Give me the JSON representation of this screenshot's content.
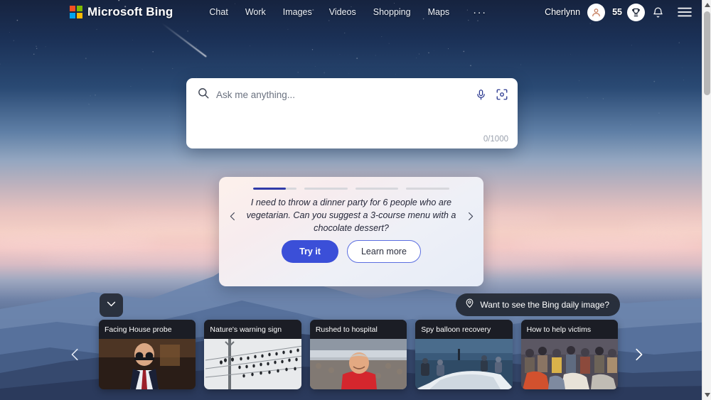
{
  "brand": {
    "name": "Microsoft Bing",
    "logo_icon": "microsoft-logo-icon"
  },
  "nav": {
    "items": [
      {
        "label": "Chat"
      },
      {
        "label": "Work"
      },
      {
        "label": "Images"
      },
      {
        "label": "Videos"
      },
      {
        "label": "Shopping"
      },
      {
        "label": "Maps"
      }
    ],
    "more_label": "···"
  },
  "account": {
    "username": "Cherlynn",
    "avatar_icon": "person-avatar-icon",
    "rewards_points": "55",
    "rewards_icon": "trophy-icon",
    "notifications_icon": "bell-icon",
    "menu_icon": "hamburger-menu-icon"
  },
  "search": {
    "placeholder": "Ask me anything...",
    "value": "",
    "search_icon": "search-icon",
    "mic_icon": "microphone-icon",
    "camera_icon": "visual-search-camera-icon",
    "counter": "0/1000"
  },
  "suggestion": {
    "progress": [
      75,
      0,
      0,
      0
    ],
    "prompt": "I need to throw a dinner party for 6 people who are vegetarian. Can you suggest a 3-course menu with a chocolate dessert?",
    "prev_icon": "chevron-left-icon",
    "next_icon": "chevron-right-icon",
    "try_label": "Try it",
    "learn_label": "Learn more",
    "accent_color": "#3b4fd8"
  },
  "expand_button": {
    "icon": "chevron-down-icon"
  },
  "daily_image_pill": {
    "label": "Want to see the Bing daily image?",
    "icon": "location-pin-icon"
  },
  "news": {
    "prev_icon": "chevron-left-icon",
    "next_icon": "chevron-right-icon",
    "cards": [
      {
        "title": "Facing House probe",
        "image": "man-in-suit-at-hearing"
      },
      {
        "title": "Nature's warning sign",
        "image": "birds-on-power-lines"
      },
      {
        "title": "Rushed to hospital",
        "image": "man-in-red-shirt-stadium"
      },
      {
        "title": "Spy balloon recovery",
        "image": "navy-crew-recovering-balloon"
      },
      {
        "title": "How to help victims",
        "image": "crowd-receiving-aid"
      }
    ]
  },
  "scrollbar": {
    "up_icon": "scroll-up-arrow-icon",
    "down_icon": "scroll-down-arrow-icon"
  }
}
